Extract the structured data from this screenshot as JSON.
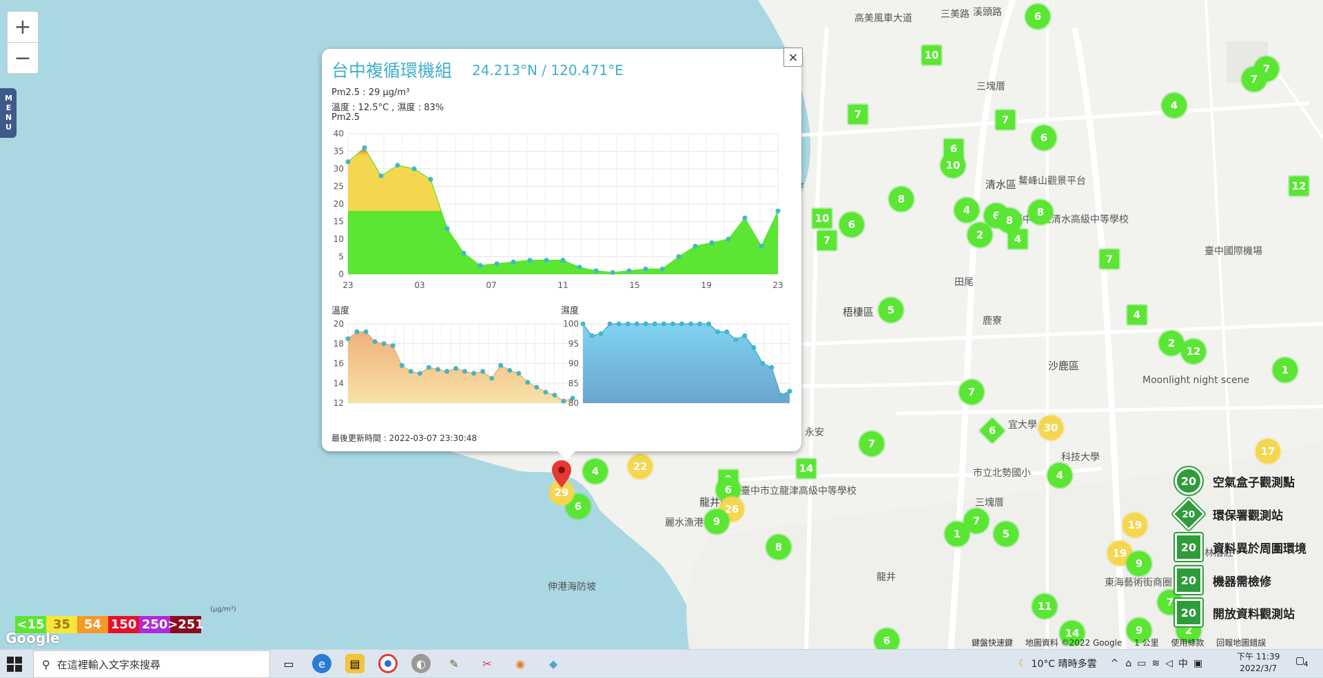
{
  "map": {
    "zoom_in": "+",
    "zoom_out": "−",
    "menu_label": "MENU",
    "labels": [
      {
        "text": "高美風車大道"
      },
      {
        "text": "三美路"
      },
      {
        "text": "溪頭路"
      },
      {
        "text": "三塊厝"
      },
      {
        "text": "石汴仔"
      },
      {
        "text": "清水區"
      },
      {
        "text": "鰲峰山觀景平台"
      },
      {
        "text": "臺中市立清水高級中等學校"
      },
      {
        "text": "田尾"
      },
      {
        "text": "梧棲區"
      },
      {
        "text": "鹿寮"
      },
      {
        "text": "沙鹿區"
      },
      {
        "text": "Moonlight night scene"
      },
      {
        "text": "臺中國際機場"
      },
      {
        "text": "市立北勢國小"
      },
      {
        "text": "三塊厝"
      },
      {
        "text": "龍井區"
      },
      {
        "text": "臺中市立龍津高級中等學校"
      },
      {
        "text": "麗水漁港"
      },
      {
        "text": "伸港海防坡"
      },
      {
        "text": "東海藝術街商圈"
      },
      {
        "text": "林厝莊"
      },
      {
        "text": "龍井"
      },
      {
        "text": "永安"
      },
      {
        "text": "宜大學"
      },
      {
        "text": "科技大學"
      }
    ],
    "markers": [
      {
        "v": "6"
      },
      {
        "v": "10"
      },
      {
        "v": "7"
      },
      {
        "v": "7"
      },
      {
        "v": "7"
      },
      {
        "v": "4"
      },
      {
        "v": "7"
      },
      {
        "v": "6"
      },
      {
        "v": "6"
      },
      {
        "v": "10"
      },
      {
        "v": "8"
      },
      {
        "v": "4"
      },
      {
        "v": "6"
      },
      {
        "v": "8"
      },
      {
        "v": "8"
      },
      {
        "v": "2"
      },
      {
        "v": "4"
      },
      {
        "v": "10"
      },
      {
        "v": "6"
      },
      {
        "v": "7"
      },
      {
        "v": "7"
      },
      {
        "v": "12"
      },
      {
        "v": "4"
      },
      {
        "v": "5"
      },
      {
        "v": "2"
      },
      {
        "v": "12"
      },
      {
        "v": "1"
      },
      {
        "v": "7"
      },
      {
        "v": "6"
      },
      {
        "v": "30"
      },
      {
        "v": "7"
      },
      {
        "v": "17"
      },
      {
        "v": "4"
      },
      {
        "v": "14"
      },
      {
        "v": "22"
      },
      {
        "v": "4"
      },
      {
        "v": "6"
      },
      {
        "v": "9"
      },
      {
        "v": "6"
      },
      {
        "v": "26"
      },
      {
        "v": "9"
      },
      {
        "v": "8"
      },
      {
        "v": "1"
      },
      {
        "v": "7"
      },
      {
        "v": "5"
      },
      {
        "v": "19"
      },
      {
        "v": "19"
      },
      {
        "v": "9"
      },
      {
        "v": "7"
      },
      {
        "v": "11"
      },
      {
        "v": "6"
      },
      {
        "v": "14"
      },
      {
        "v": "9"
      },
      {
        "v": "2"
      },
      {
        "v": "29"
      }
    ]
  },
  "popup": {
    "title": "台中複循環機組",
    "coords": "24.213°N / 120.471°E",
    "pm25_line": "Pm2.5 : 29 μg/m³",
    "weather_line": "溫度 : 12.5°C , 濕度 : 83%",
    "pm_chart_label": "Pm2.5",
    "temp_chart_label": "溫度",
    "hum_chart_label": "濕度",
    "updated": "最後更新時間 : 2022-03-07 23:30:48",
    "close": "×"
  },
  "chart_data": [
    {
      "type": "area",
      "title": "Pm2.5",
      "x_ticks": [
        "23",
        "03",
        "07",
        "11",
        "15",
        "19",
        "23"
      ],
      "ylim": [
        0,
        40
      ],
      "y_ticks": [
        0,
        5,
        10,
        15,
        20,
        25,
        30,
        35,
        40
      ],
      "grid": true,
      "values": [
        32,
        36,
        28,
        31,
        30,
        27,
        13,
        6,
        2.5,
        3,
        3.5,
        4,
        4,
        4,
        2,
        1,
        0.5,
        1,
        1.5,
        1.5,
        5,
        8,
        9,
        10,
        16,
        8,
        18
      ]
    },
    {
      "type": "area",
      "title": "溫度",
      "ylim": [
        12,
        20
      ],
      "y_ticks": [
        12,
        14,
        16,
        18,
        20
      ],
      "grid": true,
      "values": [
        18.5,
        19.2,
        19.2,
        18.2,
        18,
        17.8,
        15.8,
        15.2,
        15.0,
        15.6,
        15.4,
        15.2,
        15.5,
        15.2,
        15.0,
        15.2,
        14.5,
        15.8,
        15.3,
        15.0,
        14.1,
        13.6,
        13.1,
        12.8,
        12.2,
        12.5
      ]
    },
    {
      "type": "area",
      "title": "濕度",
      "ylim": [
        80,
        100
      ],
      "y_ticks": [
        80,
        85,
        90,
        95,
        100
      ],
      "grid": true,
      "values": [
        100,
        97,
        97.5,
        100,
        100,
        100,
        100,
        100,
        100,
        100,
        100,
        100,
        100,
        100,
        100,
        98,
        98,
        96,
        97,
        94,
        90,
        89,
        82,
        83
      ]
    }
  ],
  "legend": {
    "unit": "(μg/m³)",
    "items": [
      {
        "label": "<15",
        "color": "#5ae633"
      },
      {
        "label": "35",
        "color": "#f5e637"
      },
      {
        "label": "54",
        "color": "#f59a2a"
      },
      {
        "label": "150",
        "color": "#e8102b"
      },
      {
        "label": "250",
        "color": "#b02bd6"
      },
      {
        "label": ">251",
        "color": "#8a0d1d"
      }
    ]
  },
  "station_legend": [
    {
      "icon": "20",
      "label": "空氣盒子觀測點"
    },
    {
      "icon": "20",
      "label": "環保署觀測站"
    },
    {
      "icon": "20",
      "label": "資料異於周圍環境"
    },
    {
      "icon": "20",
      "label": "機器需檢修"
    },
    {
      "icon": "20",
      "label": "開放資料觀測站"
    }
  ],
  "attribution": {
    "shortcuts": "鍵盤快速鍵",
    "mapdata": "地圖資料 ©2022 Google",
    "scale": "1 公里",
    "terms": "使用條款",
    "report": "回報地圖錯誤",
    "google": "Google"
  },
  "taskbar": {
    "search_placeholder": "在這裡輸入文字來搜尋",
    "weather": "10°C  晴時多雲",
    "ime": "中",
    "time": "下午 11:39",
    "date": "2022/3/7",
    "notifications": "4"
  }
}
